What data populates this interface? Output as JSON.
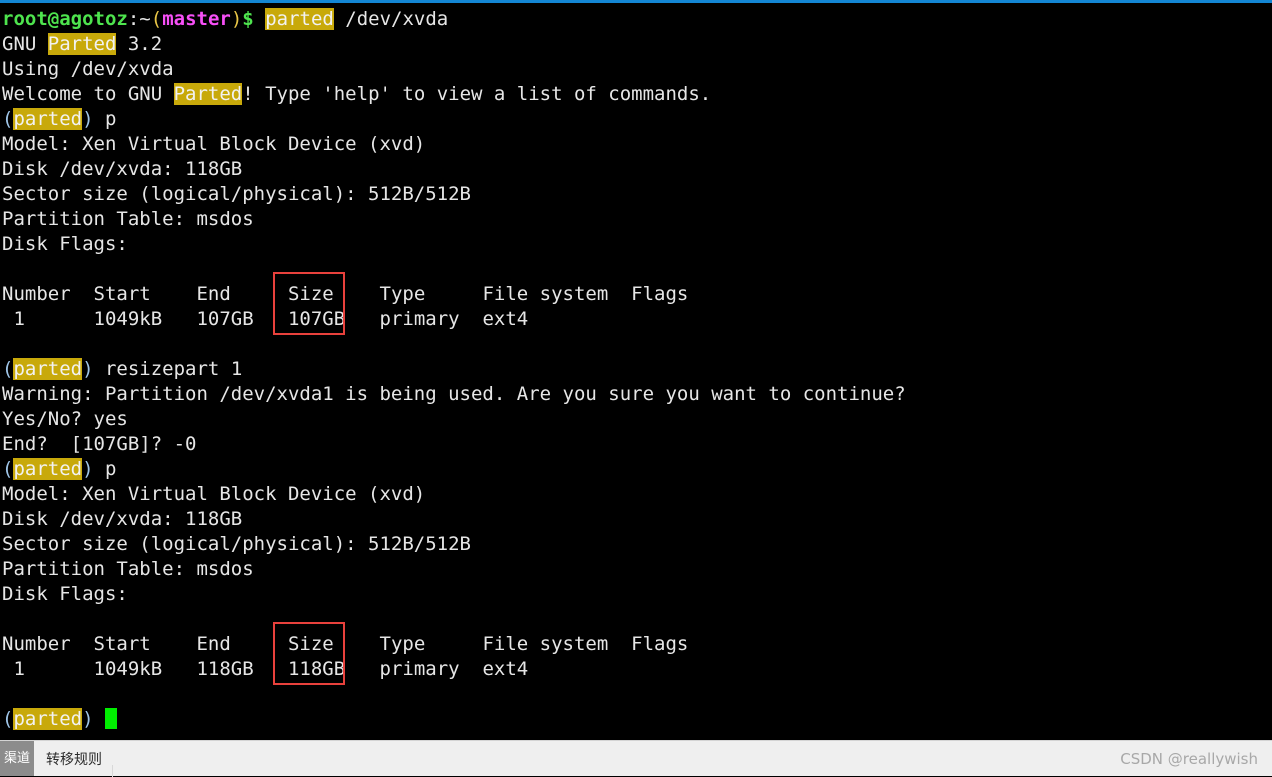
{
  "window": {
    "border_color": "#1386d4",
    "background": "#000000"
  },
  "terminal": {
    "foreground": "#e6e6e6",
    "highlight_bg": "#c8a90a",
    "cursor_color": "#00ee00",
    "prompt": {
      "user_host": "root@agotoz",
      "path": ":~",
      "branch_open": "(",
      "branch": "master",
      "branch_close": ")",
      "dollar": "$",
      "command_highlight": "parted",
      "command_args": " /dev/xvda"
    },
    "lines": {
      "l_gnu_parted_prefix": "GNU ",
      "l_gnu_parted_hl": "Parted",
      "l_gnu_parted_suffix": " 3.2",
      "l_using": "Using /dev/xvda",
      "l_welcome_prefix": "Welcome to GNU ",
      "l_welcome_hl": "Parted",
      "l_welcome_suffix": "! Type 'help' to view a list of commands.",
      "l_parted_p_cmd": " p",
      "l_model": "Model: Xen Virtual Block Device (xvd)",
      "l_disk": "Disk /dev/xvda: 118GB",
      "l_sector": "Sector size (logical/physical): 512B/512B",
      "l_table": "Partition Table: msdos",
      "l_flags": "Disk Flags:",
      "l_resizepart_cmd": " resizepart 1",
      "l_warning": "Warning: Partition /dev/xvda1 is being used. Are you sure you want to continue?",
      "l_yesno": "Yes/No? yes",
      "l_end": "End?  [107GB]? -0",
      "prompt_paren_open": "(",
      "prompt_hl": "parted",
      "prompt_paren_close": ")",
      "l_final_prompt_space": " "
    },
    "table_one": {
      "headers_text": "Number  Start    End      Size    Type     File system  Flags",
      "header_number": "Number",
      "header_start": "Start",
      "header_end": "End",
      "header_size": "Size",
      "header_type": "Type",
      "header_filesystem": "File system",
      "header_flags": "Flags",
      "row_number": "1",
      "row_start": "1049kB",
      "row_end": "107GB",
      "row_size": "107GB",
      "row_type": "primary",
      "row_filesystem": "ext4",
      "row_flags": "",
      "row_line_pre": " 1      1049kB   107GB   ",
      "row_line_post": "   primary  ext4"
    },
    "table_two": {
      "header_number": "Number",
      "header_start": "Start",
      "header_end": "End",
      "header_size": "Size",
      "header_type": "Type",
      "header_filesystem": "File system",
      "header_flags": "Flags",
      "row_number": "1",
      "row_start": "1049kB",
      "row_end": "118GB",
      "row_size": "118GB",
      "row_type": "primary",
      "row_filesystem": "ext4",
      "row_flags": "",
      "row_line_pre": " 1      1049kB   118GB   ",
      "row_line_post": "   primary  ext4"
    },
    "header_line_pre": "Number  Start    End     ",
    "header_line_post": "    Type     File system  Flags",
    "annotations": {
      "box_color": "#e8413c",
      "box_1_target": "107GB",
      "box_2_target": "118GB"
    }
  },
  "taskbar": {
    "badge_text": "渠道",
    "item_label": "转移规则",
    "watermark": "CSDN @reallywish"
  }
}
